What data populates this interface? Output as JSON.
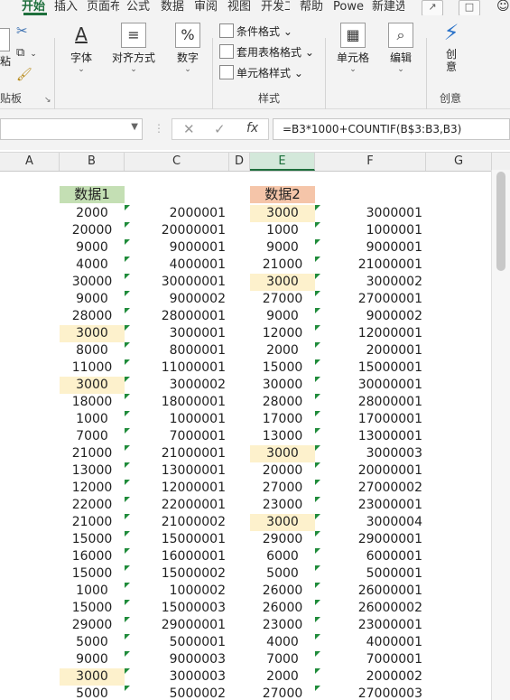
{
  "ribbon_tabs": [
    "开始",
    "插入",
    "页面布",
    "公式",
    "数据",
    "审阅",
    "视图",
    "开发工",
    "帮助",
    "Powe",
    "新建选"
  ],
  "active_tab": "开始",
  "ribbon": {
    "paste_label": "粘",
    "clipboard_group": "贴板",
    "font": "字体",
    "alignment": "对齐方式",
    "number": "数字",
    "cond_format": "条件格式",
    "table_format": "套用表格格式",
    "cell_styles": "单元格样式",
    "styles_group": "样式",
    "cells": "单元格",
    "editing": "编辑",
    "creative": "创意",
    "creative_group": "创意"
  },
  "formula_bar": {
    "name_box": "",
    "formula": "=B3*1000+COUNTIF(B$3:B3,B3)"
  },
  "columns": [
    "A",
    "B",
    "C",
    "D",
    "E",
    "F",
    "G"
  ],
  "selected_column": "E",
  "headers": {
    "b": "数据1",
    "e": "数据2"
  },
  "colors": {
    "green_header": "#c4dfb4",
    "orange_header": "#f5c5a9",
    "highlight": "#fdf1cc",
    "accent": "#1e6f3c",
    "error_triangle": "#1f8b3a"
  },
  "table": {
    "b": [
      "2000",
      "20000",
      "9000",
      "4000",
      "30000",
      "9000",
      "28000",
      "3000",
      "8000",
      "11000",
      "3000",
      "18000",
      "1000",
      "7000",
      "21000",
      "13000",
      "12000",
      "22000",
      "21000",
      "15000",
      "16000",
      "15000",
      "1000",
      "15000",
      "29000",
      "5000",
      "9000",
      "3000",
      "5000"
    ],
    "c": [
      "2000001",
      "20000001",
      "9000001",
      "4000001",
      "30000001",
      "9000002",
      "28000001",
      "3000001",
      "8000001",
      "11000001",
      "3000002",
      "18000001",
      "1000001",
      "7000001",
      "21000001",
      "13000001",
      "12000001",
      "22000001",
      "21000002",
      "15000001",
      "16000001",
      "15000002",
      "1000002",
      "15000003",
      "29000001",
      "5000001",
      "9000003",
      "3000003",
      "5000002"
    ],
    "e": [
      "3000",
      "1000",
      "9000",
      "21000",
      "3000",
      "27000",
      "9000",
      "12000",
      "2000",
      "15000",
      "30000",
      "28000",
      "17000",
      "13000",
      "3000",
      "20000",
      "27000",
      "23000",
      "3000",
      "29000",
      "6000",
      "5000",
      "26000",
      "26000",
      "23000",
      "4000",
      "7000",
      "2000",
      "27000"
    ],
    "f": [
      "3000001",
      "1000001",
      "9000001",
      "21000001",
      "3000002",
      "27000001",
      "9000002",
      "12000001",
      "2000001",
      "15000001",
      "30000001",
      "28000001",
      "17000001",
      "13000001",
      "3000003",
      "20000001",
      "27000002",
      "23000001",
      "3000004",
      "29000001",
      "6000001",
      "5000001",
      "26000001",
      "26000002",
      "23000001",
      "4000001",
      "7000001",
      "2000002",
      "27000003"
    ]
  },
  "highlight_b_rows": [
    7,
    10,
    27
  ],
  "highlight_e_rows": [
    0,
    4,
    14,
    18
  ]
}
